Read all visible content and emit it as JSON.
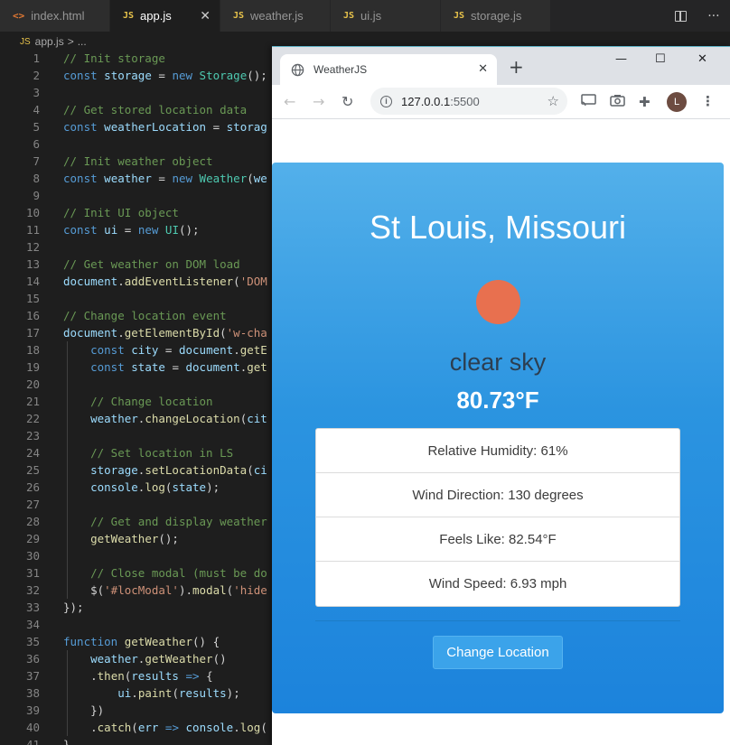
{
  "editor": {
    "tabs": [
      {
        "label": "index.html",
        "icon": "html-file-icon",
        "active": false
      },
      {
        "label": "app.js",
        "icon": "js-file-icon",
        "active": true
      },
      {
        "label": "weather.js",
        "icon": "js-file-icon",
        "active": false
      },
      {
        "label": "ui.js",
        "icon": "js-file-icon",
        "active": false
      },
      {
        "label": "storage.js",
        "icon": "js-file-icon",
        "active": false
      }
    ],
    "close_glyph": "✕",
    "breadcrumb": {
      "file_badge": "JS",
      "file": "app.js",
      "separator": ">",
      "rest": "..."
    },
    "code_lines": [
      "// Init storage",
      "const storage = new Storage();",
      "",
      "// Get stored location data",
      "const weatherLocation = storag",
      "",
      "// Init weather object",
      "const weather = new Weather(we",
      "",
      "// Init UI object",
      "const ui = new UI();",
      "",
      "// Get weather on DOM load",
      "document.addEventListener('DOM",
      "",
      "// Change location event",
      "document.getElementById('w-cha",
      "    const city = document.getE",
      "    const state = document.get",
      "",
      "    // Change location",
      "    weather.changeLocation(cit",
      "",
      "    // Set location in LS",
      "    storage.setLocationData(ci",
      "    console.log(state);",
      "",
      "    // Get and display weather",
      "    getWeather();",
      "",
      "    // Close modal (must be do",
      "    $('#locModal').modal('hide",
      "});",
      "",
      "function getWeather() {",
      "    weather.getWeather()",
      "    .then(results => {",
      "        ui.paint(results);",
      "    })",
      "    .catch(err => console.log(",
      "}"
    ]
  },
  "browser": {
    "tab_title": "WeatherJS",
    "tab_icon": "globe-icon",
    "new_tab_glyph": "+",
    "window_controls": {
      "minimize": "—",
      "maximize": "☐",
      "close": "✕"
    },
    "url_host": "127.0.0.1",
    "url_port": ":5500"
  },
  "weather": {
    "location": "St Louis, Missouri",
    "icon_color": "#e8704f",
    "description": "clear sky",
    "temperature": "80.73°F",
    "details": [
      "Relative Humidity: 61%",
      "Wind Direction: 130 degrees",
      "Feels Like: 82.54°F",
      "Wind Speed: 6.93 mph"
    ],
    "change_button": "Change Location"
  },
  "avatar_letter": "L"
}
